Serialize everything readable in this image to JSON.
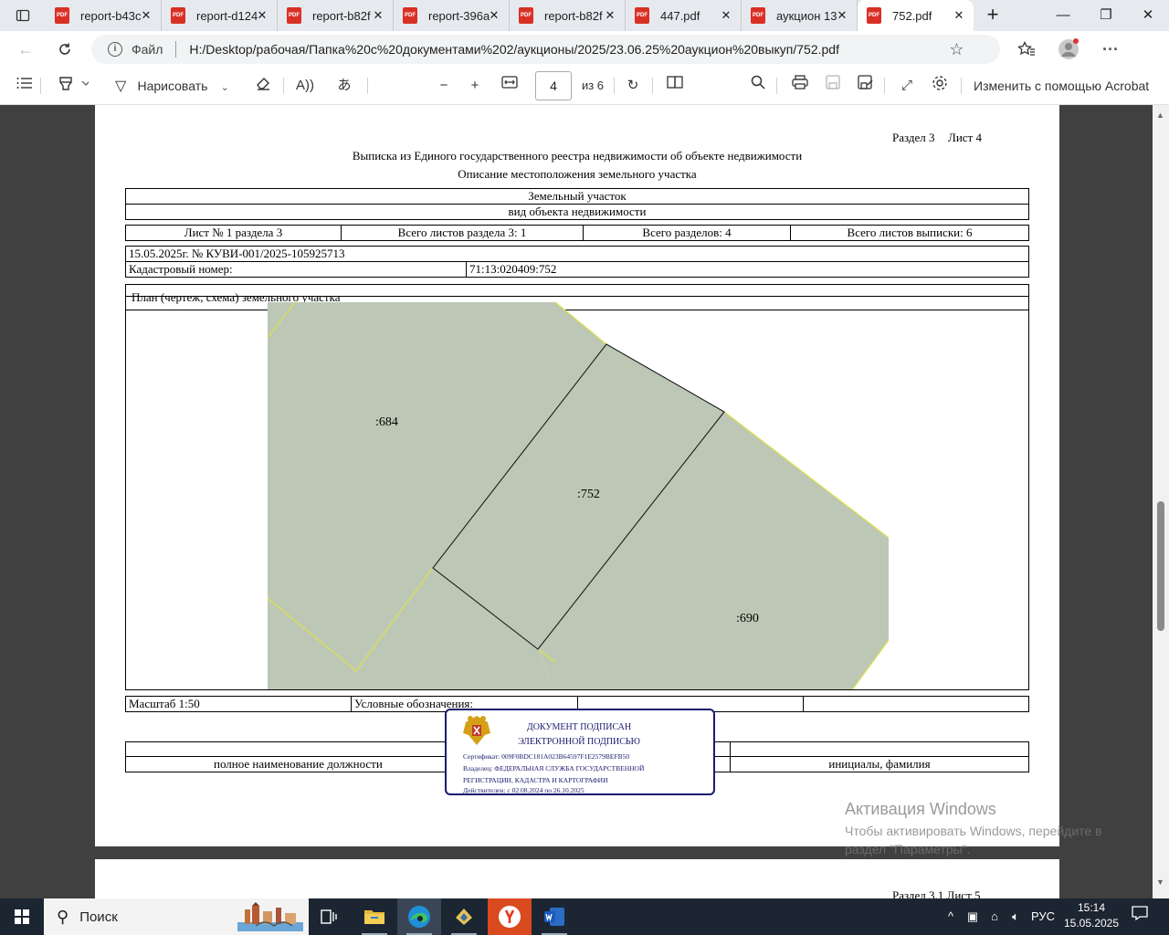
{
  "browser": {
    "tabs": [
      {
        "label": "report-b43c",
        "active": false
      },
      {
        "label": "report-d124",
        "active": false
      },
      {
        "label": "report-b82f",
        "active": false
      },
      {
        "label": "report-396a",
        "active": false
      },
      {
        "label": "report-b82f",
        "active": false
      },
      {
        "label": "447.pdf",
        "active": false
      },
      {
        "label": "аукцион 13",
        "active": false
      },
      {
        "label": "752.pdf",
        "active": true
      }
    ],
    "pdf_icon_text": "PDF",
    "address": {
      "scheme_label": "Файл",
      "url": "H:/Desktop/рабочая/Папка%20с%20документами%202/аукционы/2025/23.06.25%20аукцион%20выкуп/752.pdf"
    }
  },
  "pdf_toolbar": {
    "draw_label": "Нарисовать",
    "page_current": "4",
    "page_total": "из 6",
    "acrobat_label": "Изменить с помощью Acrobat"
  },
  "document": {
    "header_section": "Раздел 3",
    "header_sheet": "Лист 4",
    "title1": "Выписка из Единого государственного реестра недвижимости об объекте недвижимости",
    "title2": "Описание местоположения земельного участка",
    "object_type": "Земельный участок",
    "object_type_caption": "вид объекта недвижимости",
    "sheet_no": "Лист № 1 раздела 3",
    "total_sheets_section": "Всего листов раздела 3: 1",
    "total_sections": "Всего разделов: 4",
    "total_sheets_extract": "Всего листов выписки: 6",
    "date_number": "15.05.2025г. № КУВИ-001/2025-105925713",
    "cadastral_label": "Кадастровый номер:",
    "cadastral_value": "71:13:020409:752",
    "plan_caption": "План (чертеж, схема) земельного участка",
    "plan_labels": {
      "left": ":684",
      "center": ":752",
      "right": ":690"
    },
    "plan_colors": {
      "fill": "#bcc8b5",
      "neighbor_border": "#e0e04a",
      "parcel_border": "#1a1a1a"
    },
    "scale": "Масштаб 1:50",
    "legend": "Условные обозначения:",
    "position_caption": "полное наименование должности",
    "name_caption": "инициалы, фамилия",
    "next_page_header": "Раздел 3.1 Лист 5"
  },
  "stamp": {
    "line1": "ДОКУМЕНТ ПОДПИСАН",
    "line2": "ЭЛЕКТРОННОЙ ПОДПИСЬЮ",
    "certificate": "Сертификат: 009F0BDC181A023B64597F1E2579BEFB50",
    "owner1": "Владелец: ФЕДЕРАЛЬНАЯ СЛУЖБА ГОСУДАРСТВЕННОЙ",
    "owner2": "РЕГИСТРАЦИИ, КАДАСТРА И КАРТОГРАФИИ",
    "valid": "Действителен: с 02.08.2024 по 26.10.2025"
  },
  "watermark": {
    "line1": "Активация Windows",
    "line2": "Чтобы активировать Windows, перейдите в раздел \"Параметры\"."
  },
  "taskbar": {
    "search_label": "Поиск",
    "language": "РУС",
    "time": "15:14",
    "date": "15.05.2025"
  }
}
